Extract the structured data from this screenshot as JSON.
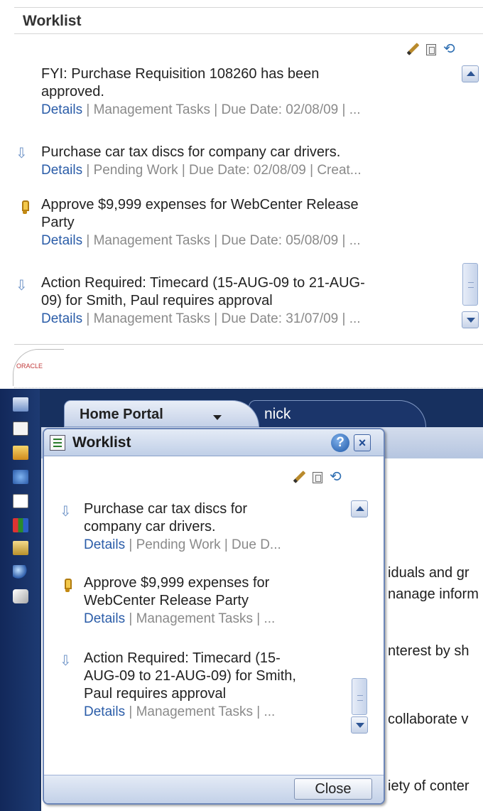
{
  "top_worklist": {
    "title": "Worklist",
    "icons": [
      "pencil-icon",
      "document-icon",
      "refresh-icon"
    ],
    "items": [
      {
        "icon": "",
        "title_lines": [
          "FYI: Purchase Requisition 108260 has been",
          "approved."
        ],
        "details": "Details",
        "meta": " | Management Tasks | Due Date: 02/08/09 | ..."
      },
      {
        "icon": "arrow-down-icon",
        "title_lines": [
          "Purchase car tax discs for company car drivers."
        ],
        "details": "Details",
        "meta": " | Pending Work | Due Date: 02/08/09 | Creat..."
      },
      {
        "icon": "priority-icon",
        "title_lines": [
          "Approve $9,999 expenses for WebCenter Release",
          "Party"
        ],
        "details": "Details",
        "meta": " | Management Tasks | Due Date: 05/08/09 | ..."
      },
      {
        "icon": "arrow-down-icon",
        "title_lines": [
          "Action Required: Timecard (15-AUG-09 to 21-AUG-",
          "09) for Smith, Paul requires approval"
        ],
        "details": "Details",
        "meta": " | Management Tasks | Due Date: 31/07/09 | ..."
      }
    ]
  },
  "portal": {
    "logo_text": "ORACLE",
    "tabs": [
      {
        "label": "Home Portal",
        "active": true
      },
      {
        "label": "nick",
        "active": false
      }
    ],
    "background_fragments": [
      "iduals and gr",
      "nanage inform",
      "nterest by sh",
      "collaborate v",
      "iety of conter"
    ]
  },
  "dialog": {
    "title": "Worklist",
    "help_label": "?",
    "close_x": "×",
    "close_button": "Close",
    "items": [
      {
        "icon": "arrow-down-icon",
        "title_lines": [
          "Purchase car tax discs for",
          "company car drivers."
        ],
        "details": "Details",
        "meta": " | Pending Work | Due D..."
      },
      {
        "icon": "priority-icon",
        "title_lines": [
          "Approve $9,999 expenses for",
          "WebCenter Release Party"
        ],
        "details": "Details",
        "meta": " | Management Tasks | ..."
      },
      {
        "icon": "arrow-down-icon",
        "title_lines": [
          "Action Required: Timecard (15-",
          "AUG-09 to 21-AUG-09) for Smith,",
          "Paul requires approval"
        ],
        "details": "Details",
        "meta": " | Management Tasks | ..."
      }
    ]
  },
  "colors": {
    "link": "#2a5ca8",
    "meta": "#8a8a8a",
    "nav_background": "#17305f"
  }
}
